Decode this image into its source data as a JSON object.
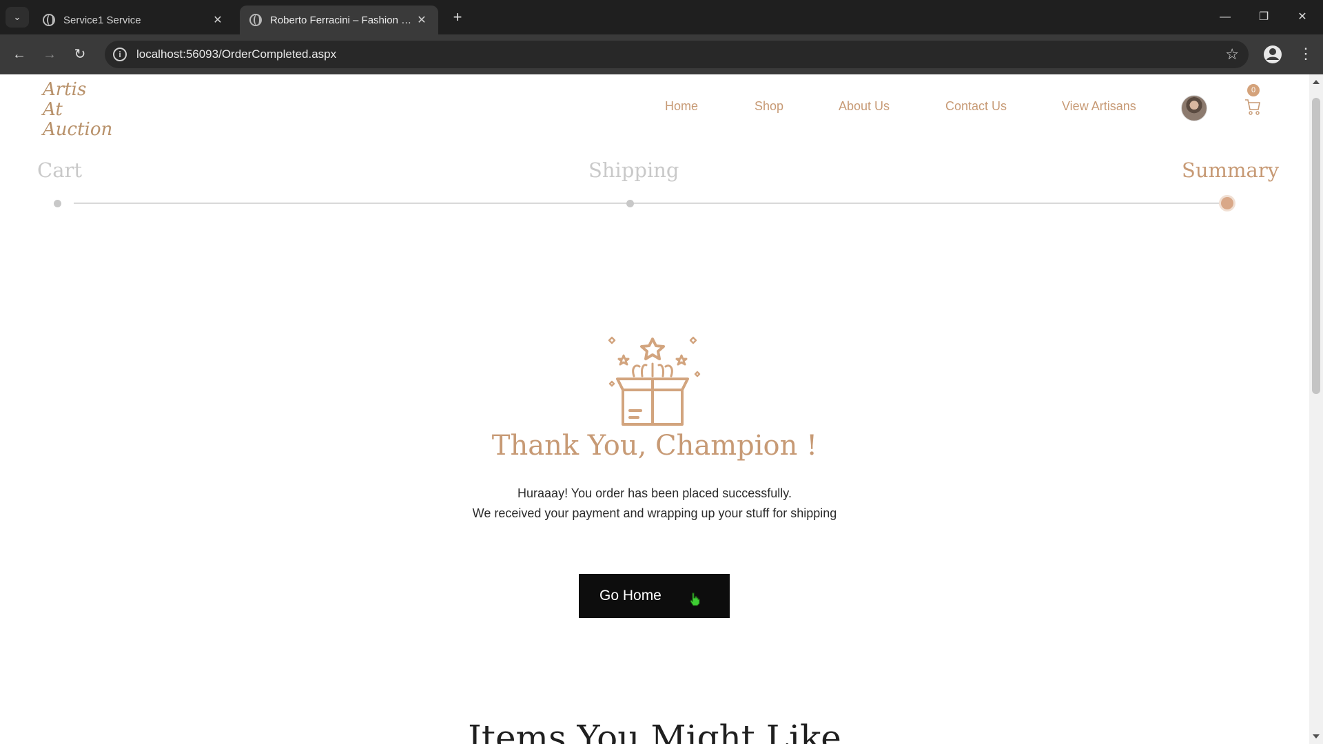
{
  "browser": {
    "tabs": [
      {
        "title": "Service1 Service",
        "active": false
      },
      {
        "title": "Roberto Ferracini – Fashion and",
        "active": true
      }
    ],
    "url": "localhost:56093/OrderCompleted.aspx",
    "icons": {
      "tab_list": "chevron-down-icon",
      "new_tab": "plus-icon",
      "back": "arrow-left-icon",
      "forward": "arrow-right-icon",
      "reload": "reload-icon",
      "site_info": "info-icon",
      "bookmark": "star-icon",
      "profile": "person-icon",
      "menu": "kebab-menu-icon"
    },
    "glyphs": {
      "tab_list": "⌄",
      "close": "✕",
      "new_tab": "+",
      "minimize": "—",
      "restore": "❐",
      "window_close": "✕",
      "back": "←",
      "forward": "→",
      "reload": "↻",
      "info": "i",
      "star": "☆",
      "menu": "⋮"
    }
  },
  "site": {
    "logo_lines": [
      "Artis",
      "At",
      "Auction"
    ],
    "nav": [
      "Home",
      "Shop",
      "About Us",
      "Contact Us",
      "View Artisans"
    ],
    "cart_count": "0"
  },
  "checkout_steps": [
    {
      "label": "Cart",
      "active": false
    },
    {
      "label": "Shipping",
      "active": false
    },
    {
      "label": "Summary",
      "active": true
    }
  ],
  "confirmation": {
    "title": "Thank You, Champion !",
    "line1": "Huraaay! You order has been placed successfully.",
    "line2": "We received your payment and wrapping up your stuff for shipping",
    "button": "Go Home"
  },
  "recommendations": {
    "title": "Items You Might Like"
  },
  "colors": {
    "accent": "#c79a75",
    "chrome_dark": "#1f1f1f",
    "button_bg": "#0d0d0d"
  }
}
